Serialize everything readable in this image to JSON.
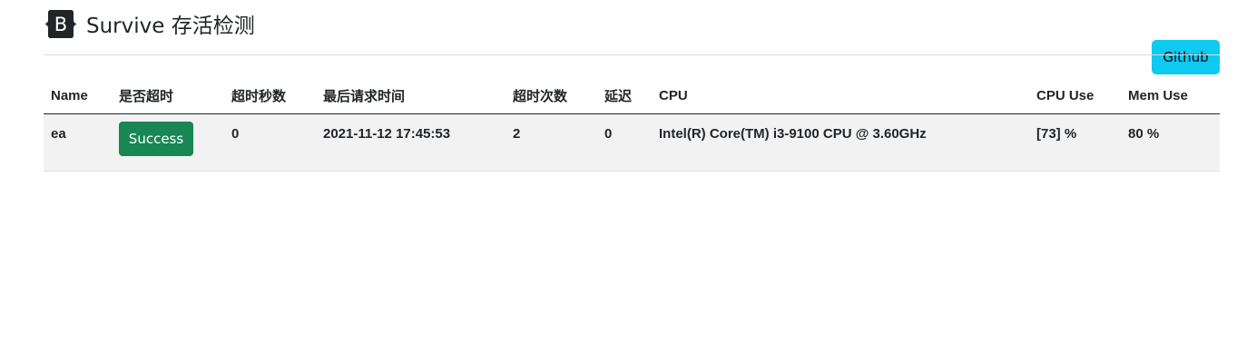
{
  "header": {
    "logo_letter": "B",
    "title": "Survive 存活检测"
  },
  "toolbar": {
    "github_label": "Github"
  },
  "colors": {
    "github_button": "#0dcaf0",
    "success_button": "#198754",
    "row_background": "#f2f2f2"
  },
  "table": {
    "columns": [
      "Name",
      "是否超时",
      "超时秒数",
      "最后请求时间",
      "超时次数",
      "延迟",
      "CPU",
      "CPU Use",
      "Mem Use"
    ],
    "rows": [
      {
        "name": "ea",
        "status": "Success",
        "timeout_seconds": "0",
        "last_request": "2021-11-12 17:45:53",
        "timeout_count": "2",
        "latency": "0",
        "cpu": "Intel(R) Core(TM) i3-9100 CPU @ 3.60GHz",
        "cpu_use": "[73] %",
        "mem_use": "80 %"
      }
    ]
  }
}
